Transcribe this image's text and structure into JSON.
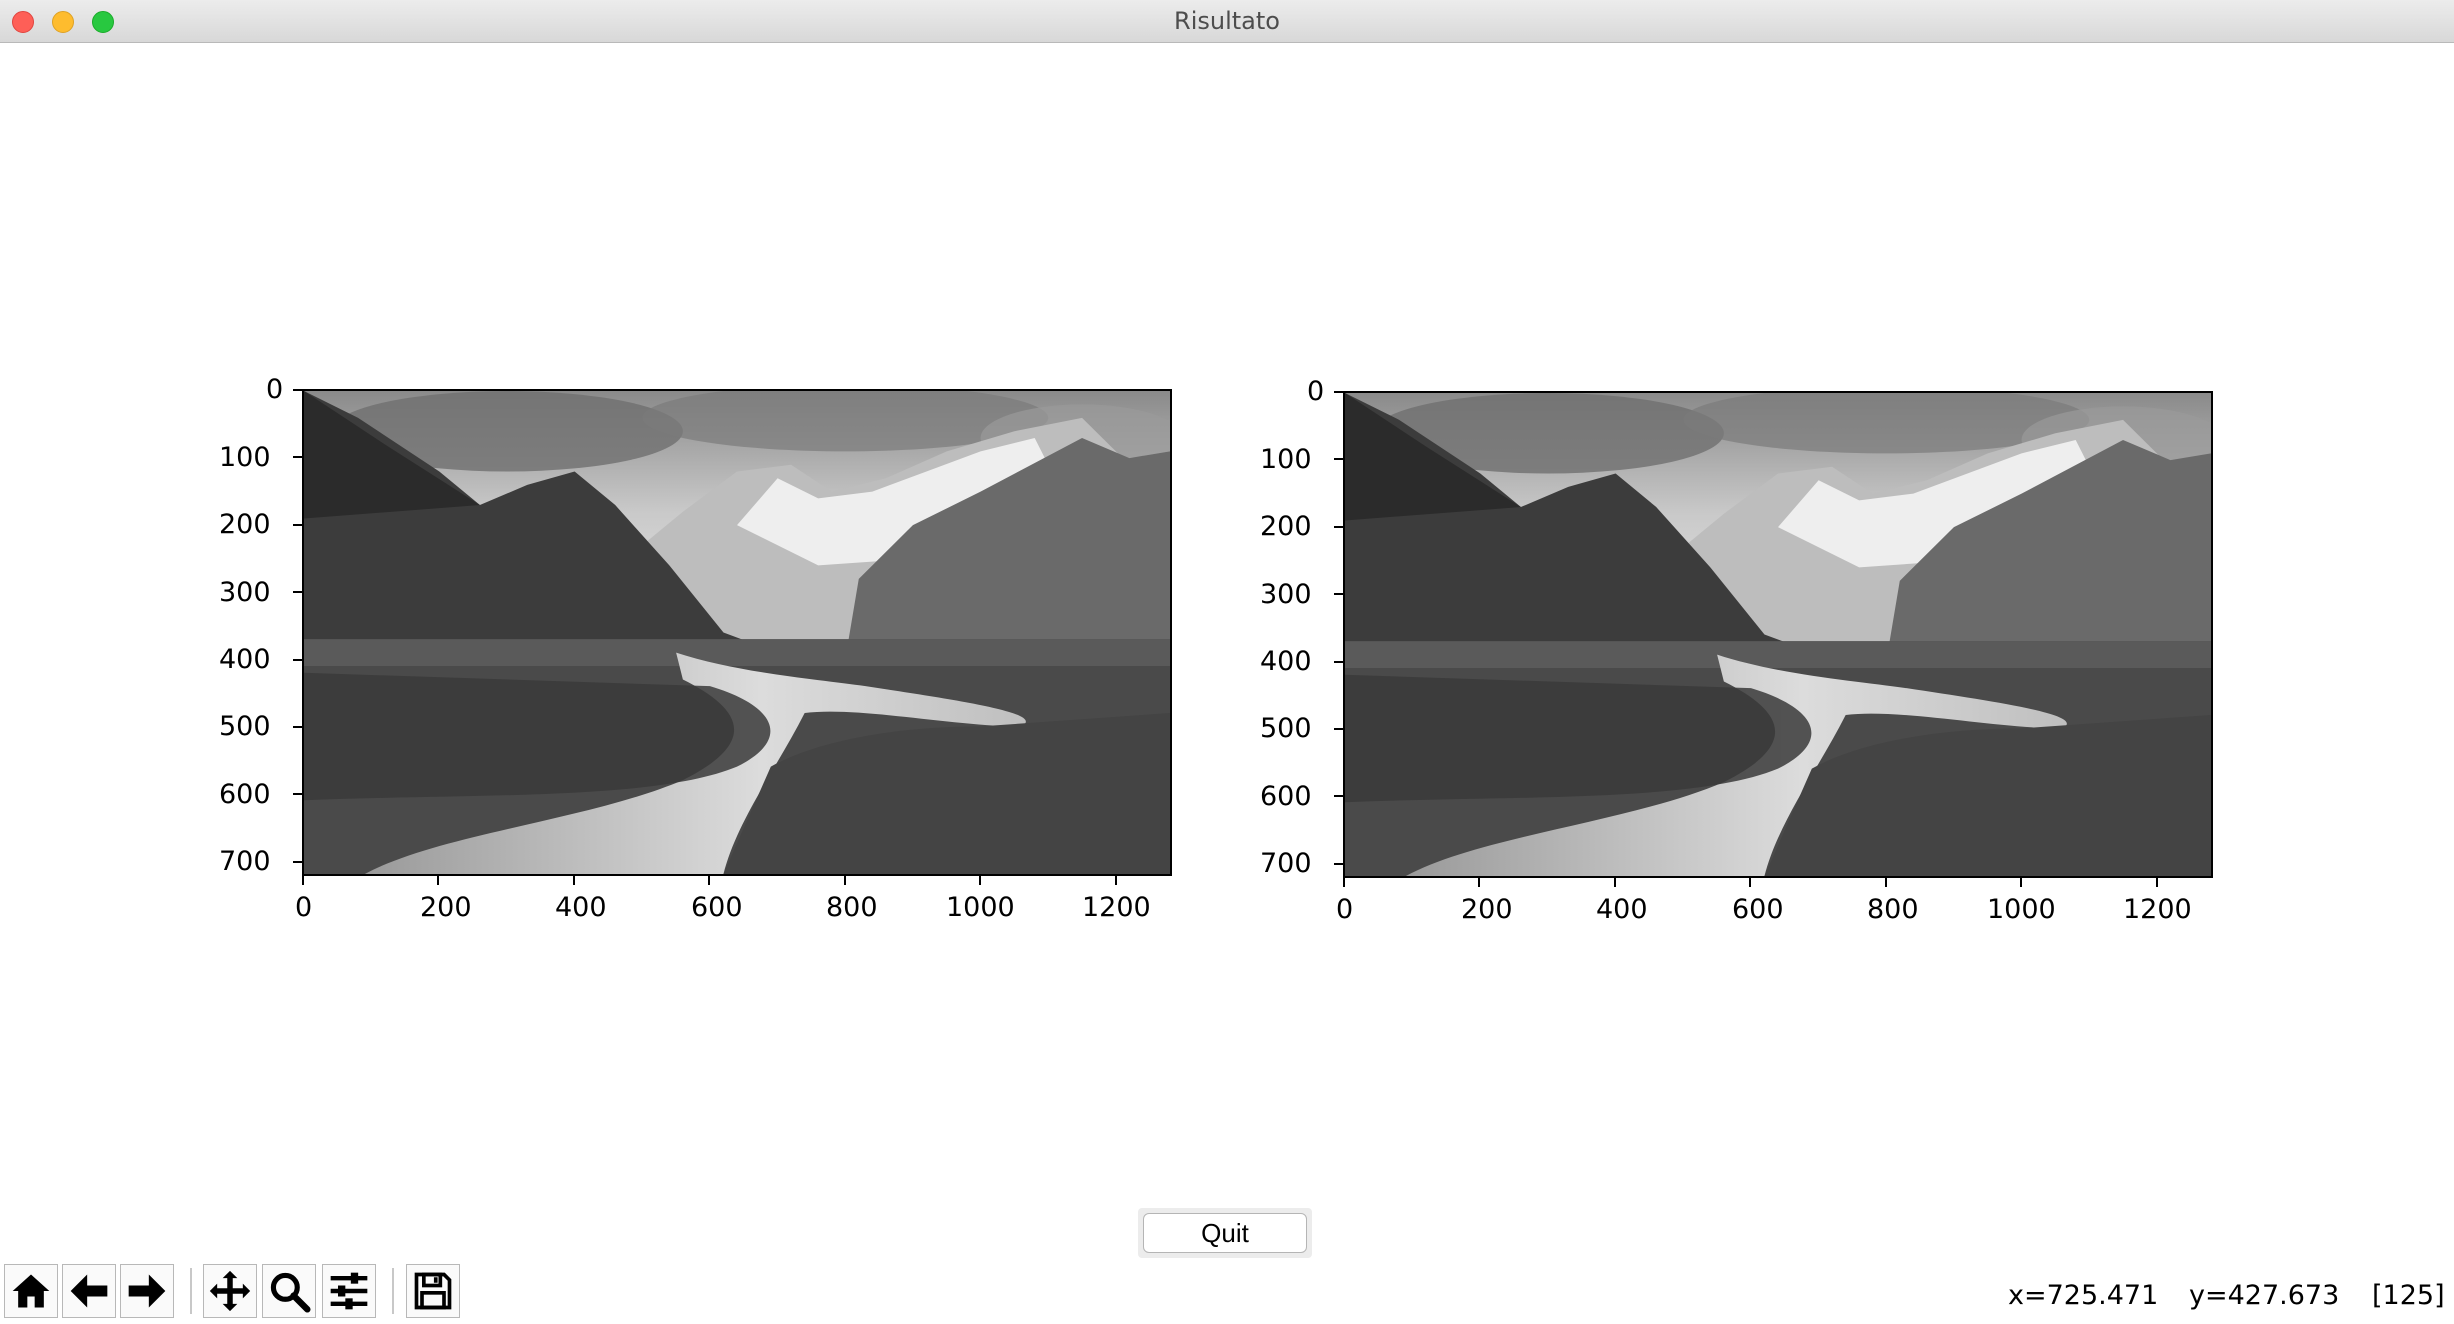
{
  "window": {
    "title": "Risultato"
  },
  "figure": {
    "axes_left": {
      "yticks": [
        "0",
        "100",
        "200",
        "300",
        "400",
        "500",
        "600",
        "700"
      ],
      "xticks": [
        "0",
        "200",
        "400",
        "600",
        "800",
        "1000",
        "1200"
      ]
    },
    "axes_right": {
      "yticks": [
        "0",
        "100",
        "200",
        "300",
        "400",
        "500",
        "600",
        "700"
      ],
      "xticks": [
        "0",
        "200",
        "400",
        "600",
        "800",
        "1000",
        "1200"
      ]
    },
    "image_description": "grayscale mountain valley landscape"
  },
  "quit_label": "Quit",
  "toolbar": {
    "buttons": [
      {
        "icon": "home-icon"
      },
      {
        "icon": "back-arrow-icon"
      },
      {
        "icon": "forward-arrow-icon"
      },
      {
        "icon": "pan-icon"
      },
      {
        "icon": "zoom-icon"
      },
      {
        "icon": "subplots-config-icon"
      },
      {
        "icon": "save-icon"
      }
    ],
    "status": {
      "x": "x=725.471",
      "y": "y=427.673",
      "value": "[125]"
    }
  }
}
